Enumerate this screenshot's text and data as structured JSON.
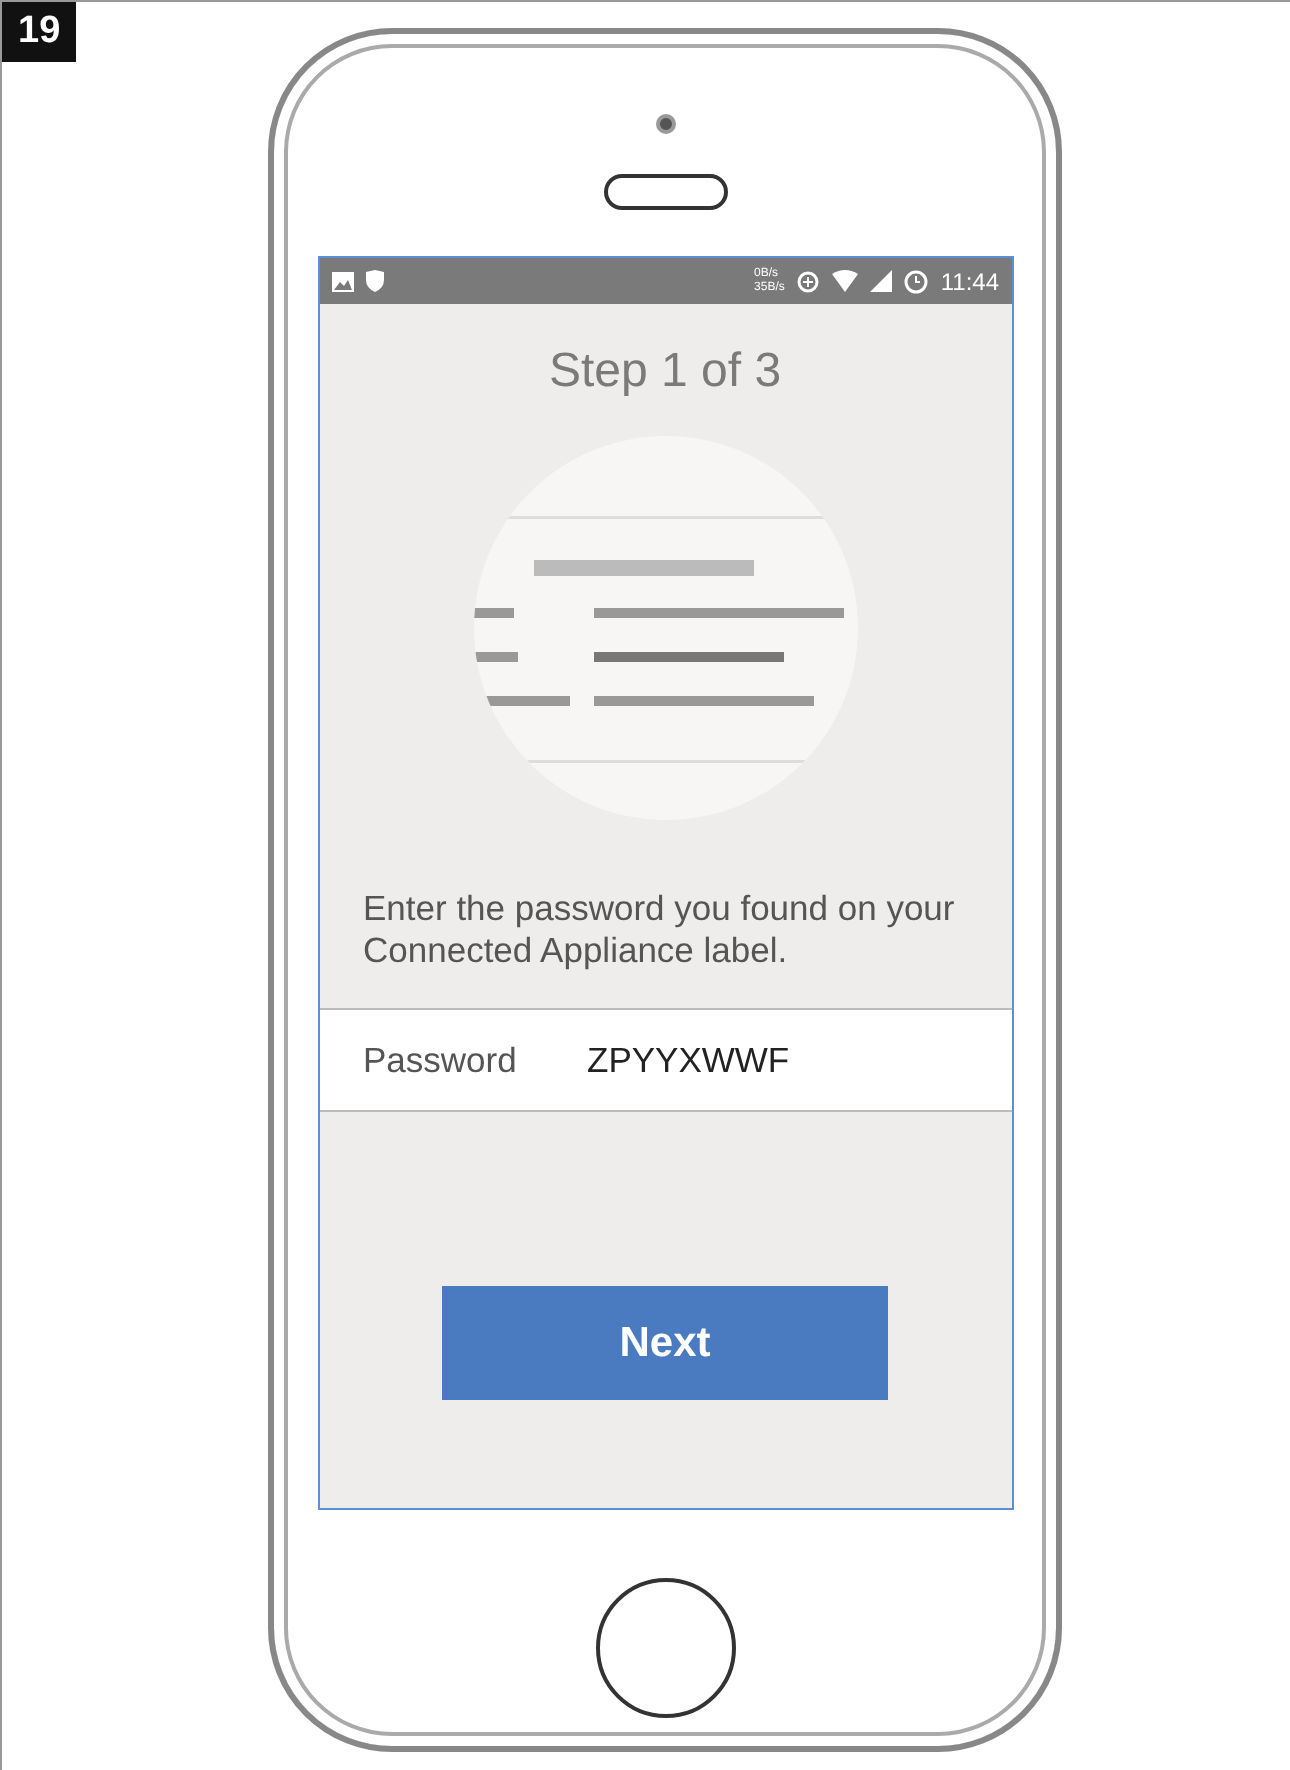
{
  "figure_number": "19",
  "status_bar": {
    "speed_down": "0B/s",
    "speed_up": "35B/s",
    "time": "11:44"
  },
  "title": "Step 1 of 3",
  "instruction": "Enter the password you found on your Connected Appliance label.",
  "password_field": {
    "label": "Password",
    "value": "ZPYYXWWF"
  },
  "next_button": "Next"
}
